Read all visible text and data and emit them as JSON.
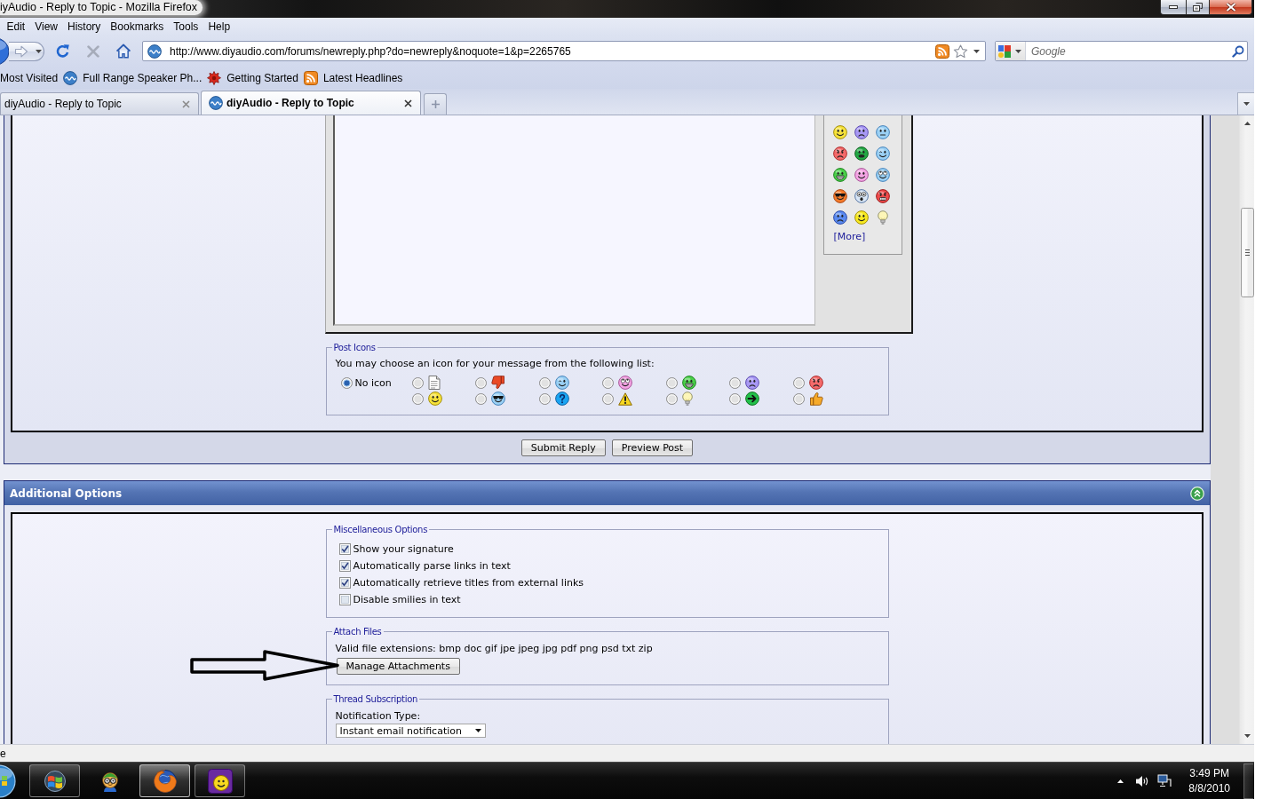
{
  "window": {
    "title": "iyAudio - Reply to Topic - Mozilla Firefox"
  },
  "menu_bar": [
    "Edit",
    "View",
    "History",
    "Bookmarks",
    "Tools",
    "Help"
  ],
  "toolbar": {
    "address": "http://www.diyaudio.com/forums/newreply.php?do=newreply&noquote=1&p=2265765",
    "search": {
      "placeholder": "Google"
    }
  },
  "bookmarks_bar": [
    "Most Visited",
    "Full Range Speaker Ph...",
    "Getting Started",
    "Latest Headlines"
  ],
  "tabs": [
    {
      "label": "diyAudio - Reply to Topic",
      "selected": false
    },
    {
      "label": "diyAudio - Reply to Topic",
      "selected": true
    }
  ],
  "editor": {
    "smilies_link": "[More]"
  },
  "post_icons": {
    "legend": "Post Icons",
    "instruction": "You may choose an icon for your message from the following list:",
    "options": [
      {
        "label": "No icon",
        "selected": true
      },
      {
        "selected": false
      },
      {
        "selected": false
      },
      {
        "selected": false
      },
      {
        "selected": false
      },
      {
        "selected": false
      },
      {
        "selected": false
      },
      {
        "selected": false
      },
      {
        "selected": false
      },
      {
        "selected": false
      },
      {
        "selected": false
      },
      {
        "selected": false
      },
      {
        "selected": false
      },
      {
        "selected": false
      },
      {
        "selected": false
      }
    ]
  },
  "form_buttons": [
    "Submit Reply",
    "Preview Post"
  ],
  "additional_options": {
    "title": "Additional Options",
    "miscellaneous": {
      "legend": "Miscellaneous Options",
      "options": [
        {
          "label": "Show your signature",
          "checked": true
        },
        {
          "label": "Automatically parse links in text",
          "checked": true
        },
        {
          "label": "Automatically retrieve titles from external links",
          "checked": true
        },
        {
          "label": "Disable smilies in text",
          "checked": false
        }
      ]
    },
    "attach_files": {
      "legend": "Attach Files",
      "extensions": "Valid file extensions: bmp doc gif jpe jpeg jpg pdf png psd txt zip",
      "button": "Manage Attachments"
    },
    "thread_subscription": {
      "legend": "Thread Subscription",
      "label": "Notification Type:",
      "value": "Instant email notification"
    }
  },
  "status_bar": {
    "text": "e"
  },
  "taskbar": {
    "apps": [
      {
        "open": true,
        "active": false
      },
      {
        "open": false,
        "active": false
      },
      {
        "open": true,
        "active": true
      },
      {
        "open": true,
        "active": false
      }
    ],
    "time": "3:49 PM",
    "date": "8/8/2010"
  }
}
